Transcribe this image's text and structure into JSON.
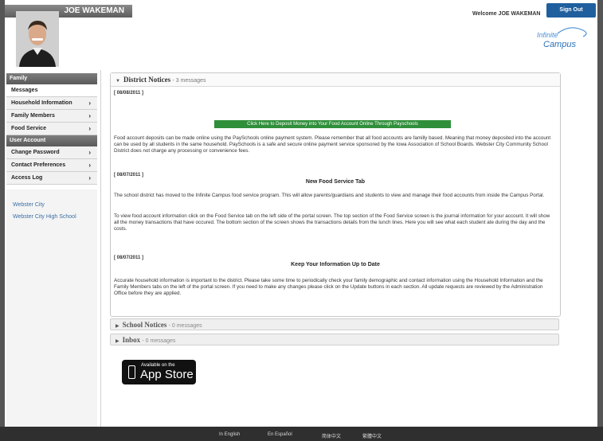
{
  "header": {
    "user_name": "JOE WAKEMAN",
    "welcome": "Welcome JOE WAKEMAN",
    "sign_out": "Sign Out",
    "logo_line1": "Infinite",
    "logo_line2": "Campus"
  },
  "nav": {
    "family_head": "Family",
    "family_items": [
      {
        "label": "Messages",
        "chevron": false
      },
      {
        "label": "Household Information",
        "chevron": true
      },
      {
        "label": "Family Members",
        "chevron": true
      },
      {
        "label": "Food Service",
        "chevron": true
      }
    ],
    "account_head": "User Account",
    "account_items": [
      {
        "label": "Change Password",
        "chevron": true
      },
      {
        "label": "Contact Preferences",
        "chevron": true
      },
      {
        "label": "Access Log",
        "chevron": true
      }
    ],
    "links": [
      "Webster City",
      "Webster City High School"
    ]
  },
  "district_notices": {
    "title": "District Notices",
    "count": "- 3 messages",
    "notices": [
      {
        "date": "[ 08/08/2011 ]",
        "button": "Click Here to Deposit Money into Your Food Account Online Through Payschools",
        "body": "Food account deposits can be made online using the PaySchools online payment system. Please remember that all food accounts are familly based. Meaning that money deposited into the account can be used by all students in the same household. PaySchools is a safe and secure online payment service sponsored by the Iowa Association of School Boards. Webster City Community School District does not charge any processing or convenience fees."
      },
      {
        "date": "[ 08/07/2011 ]",
        "title": "New Food Service Tab",
        "body1": "The school district has moved to the Infinite Campus food service program. This will allow parents/guardians and students to view and manage their food accounts from inside the Campus Portal.",
        "body2": "To view food account information click on the Food Service tab on the left side of the portal screen. The top section of the Food Service screen is the journal information for your account. It will show all the money transactions that have occured. The bottom section of the screen shows the transactions details from the lunch lines. Here you will see what each student ate during the day and the costs."
      },
      {
        "date": "[ 08/07/2011 ]",
        "title": "Keep Your Information Up to Date",
        "body": "Accurate household information is important to the district. Please take some time to periodically check your family demographic and contact information using the Household Information and the Family Members tabs on the left of the portal screen. If you need to make any changes please click on the Update buttons in each section. All update requests are reviewed by the Administration Office before they are applied."
      }
    ]
  },
  "school_notices": {
    "title": "School Notices",
    "count": "- 0 messages"
  },
  "inbox": {
    "title": "Inbox",
    "count": "- 0 messages"
  },
  "app_store": {
    "line1": "Available on the",
    "line2": "App Store"
  },
  "footer": {
    "links": [
      "In English",
      "En Español",
      "简体中文",
      "繁體中文"
    ]
  },
  "colors": {
    "signout_bg": "#1f5f9e",
    "green_button": "#2f8f3a",
    "footer_bg": "#2f2f2f"
  }
}
